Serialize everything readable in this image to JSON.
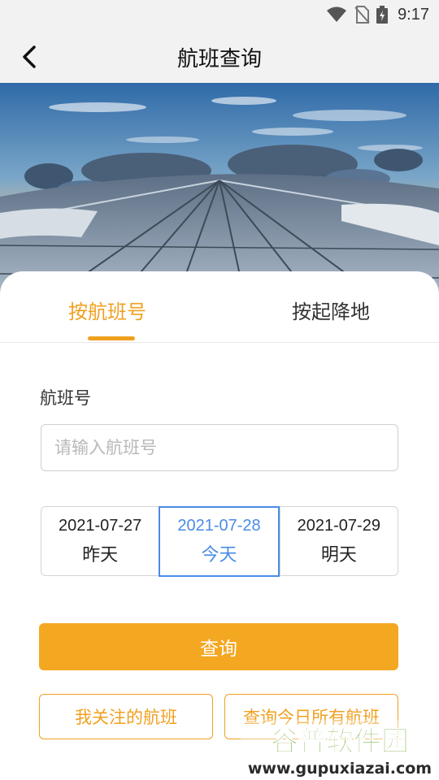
{
  "status_bar": {
    "time": "9:17",
    "icons": [
      "wifi-icon",
      "no-sim-icon",
      "battery-charging-icon"
    ]
  },
  "header": {
    "title": "航班查询",
    "back_icon": "chevron-left-icon"
  },
  "banner": {
    "description_icon": "airport-terminal-photo"
  },
  "tabs": [
    {
      "label": "按航班号",
      "active": true
    },
    {
      "label": "按起降地",
      "active": false
    }
  ],
  "form": {
    "flight_label": "航班号",
    "flight_value": "",
    "flight_placeholder": "请输入航班号"
  },
  "dates": [
    {
      "date": "2021-07-27",
      "day": "昨天",
      "selected": false
    },
    {
      "date": "2021-07-28",
      "day": "今天",
      "selected": true
    },
    {
      "date": "2021-07-29",
      "day": "明天",
      "selected": false
    }
  ],
  "buttons": {
    "query": "查询",
    "followed": "我关注的航班",
    "all_today": "查询今日所有航班"
  },
  "watermark": {
    "title": "谷普软件园",
    "url": "www.gupuxiazai.com"
  },
  "colors": {
    "accent": "#f4a721",
    "selected_date": "#4a8be6",
    "header_bg": "#f2f2f2"
  }
}
